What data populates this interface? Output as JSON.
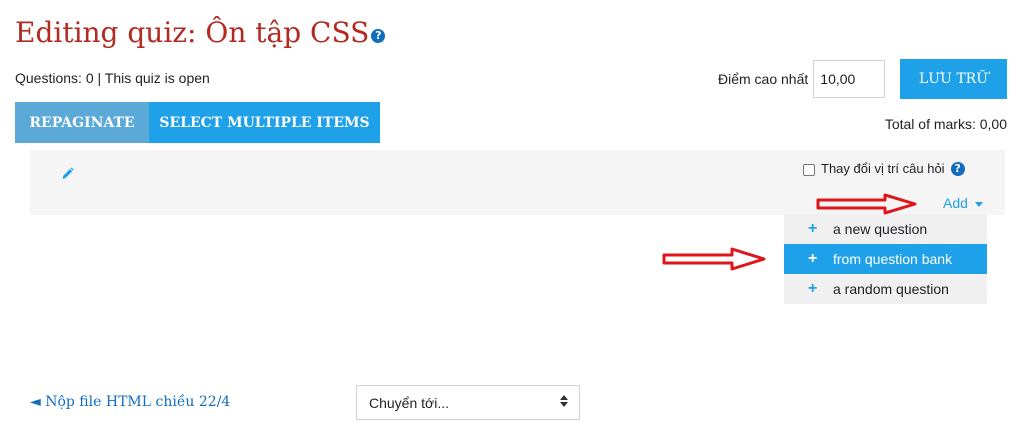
{
  "header": {
    "title": "Editing quiz: Ôn tập CSS",
    "help_symbol": "?"
  },
  "status": {
    "info": "Questions: 0 | This quiz is open",
    "total_marks": "Total of marks: 0,00"
  },
  "max_grade": {
    "label": "Điểm cao nhất",
    "value": "10,00",
    "save_label": "LƯU TRỮ"
  },
  "toolbar": {
    "repaginate_label": "REPAGINATE",
    "select_multiple_label": "SELECT MULTIPLE ITEMS"
  },
  "section": {
    "shuffle_label": "Thay đổi vị trí câu hỏi",
    "shuffle_checked": false,
    "add_label": "Add"
  },
  "add_menu": {
    "items": [
      {
        "label": "a new question",
        "icon": "plus-icon",
        "active": false
      },
      {
        "label": "from question bank",
        "icon": "plus-icon",
        "active": true
      },
      {
        "label": "a random question",
        "icon": "plus-icon",
        "active": false
      }
    ]
  },
  "footer": {
    "prev_link": "◄ Nộp file HTML chiều 22/4",
    "jump_placeholder": "Chuyển tới..."
  },
  "colors": {
    "title": "#b22a20",
    "primary": "#1ea1e8",
    "annotation_arrow": "#e0141b"
  }
}
